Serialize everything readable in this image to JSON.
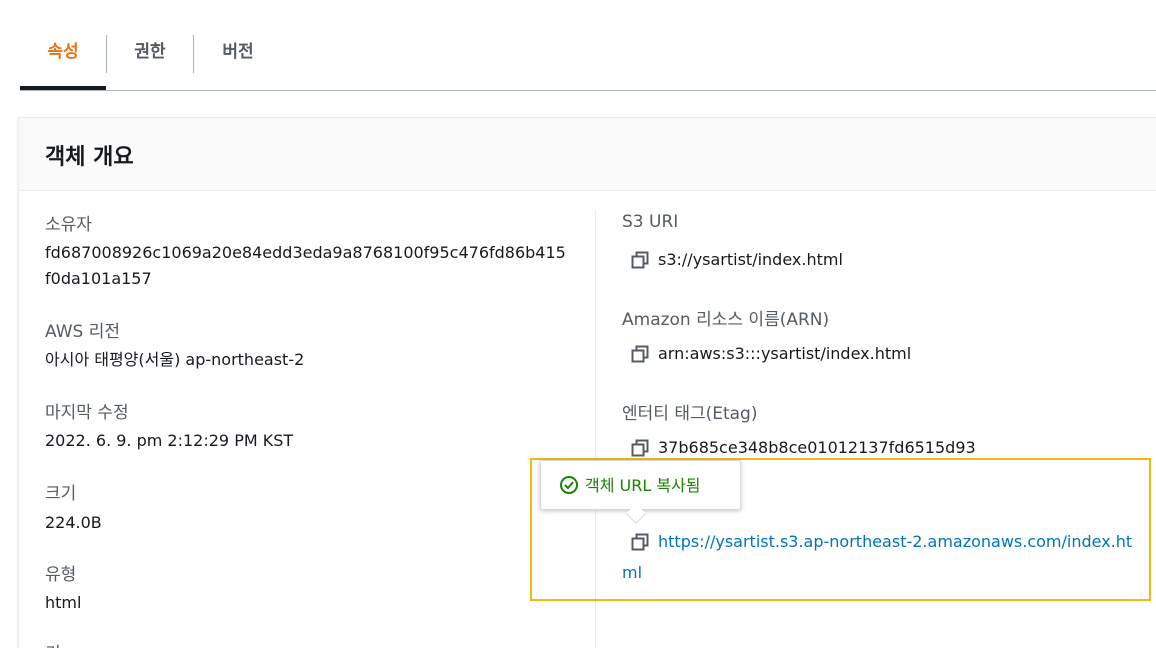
{
  "tabs": [
    {
      "label": "속성",
      "active": true
    },
    {
      "label": "권한",
      "active": false
    },
    {
      "label": "버전",
      "active": false
    }
  ],
  "panel": {
    "title": "객체 개요",
    "left": {
      "owner": {
        "label": "소유자",
        "value_line1": "fd687008926c1069a20e84edd3eda9a8768100f95c476fd86b415",
        "value_line2": "f0da101a157"
      },
      "region": {
        "label": "AWS 리전",
        "value": "아시아 태평양(서울) ap-northeast-2"
      },
      "last_modified": {
        "label": "마지막 수정",
        "value": "2022. 6. 9. pm 2:12:29 PM KST"
      },
      "size": {
        "label": "크기",
        "value": "224.0B"
      },
      "type": {
        "label": "유형",
        "value": "html"
      },
      "key": {
        "label": "키"
      }
    },
    "right": {
      "s3_uri": {
        "label": "S3 URI",
        "value": "s3://ysartist/index.html"
      },
      "arn": {
        "label": "Amazon 리소스 이름(ARN)",
        "value": "arn:aws:s3:::ysartist/index.html"
      },
      "etag": {
        "label": "엔터티 태그(Etag)",
        "value": "37b685ce348b8ce01012137fd6515d93"
      },
      "object_url": {
        "value_line1": "https://ysartist.s3.ap-northeast-2.amazonaws.com/index.ht",
        "value_line2": "ml"
      }
    }
  },
  "popover": {
    "message": "객체 URL 복사됨"
  },
  "colors": {
    "accent": "#ec7211",
    "link": "#0073bb",
    "success": "#1d8102",
    "highlight": "#f2b90f"
  },
  "icons": {
    "copy": "copy-icon",
    "success": "check-circle-icon"
  }
}
